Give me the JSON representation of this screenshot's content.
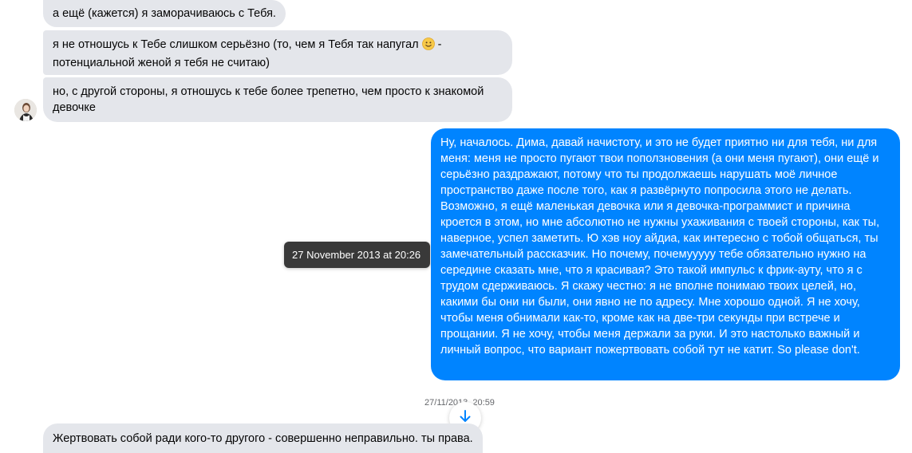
{
  "conversation": {
    "messages_in_top": [
      {
        "text": "а ещё (кажется) я заморачиваюсь  с Тебя."
      },
      {
        "text_before_emoji": "я не отношусь к Тебе слишком серьёзно (то, чем я Тебя так напугал ",
        "emoji": "slightly-smiling-face-icon",
        "text_after_emoji": " - потенциальной женой я тебя не считаю)"
      },
      {
        "text": "но, с другой стороны, я отношусь к тебе более трепетно, чем просто к знакомой девочке"
      }
    ],
    "message_out": {
      "text": "Ну, началось. Дима, давай начистоту, и это не будет приятно ни для тебя, ни для меня: меня не просто пугают твои поползновения (а они меня пугают), они ещё и серьёзно раздражают, потому что ты продолжаешь нарушать моё личное пространство даже после того, как я развёрнуто попросила этого не делать. Возможно, я ещё маленькая девочка или я девочка-программист и причина кроется в этом, но мне абсолютно не нужны ухаживания с твоей стороны, как ты, наверное, успел заметить. Ю хэв ноу айдиа, как интересно с тобой общаться, ты замечательный рассказчик. Но почему, почемууууу тебе обязательно нужно на середине сказать мне, что я красивая? Это такой импульс к фрик-ауту, что я с трудом сдерживаюсь. Я скажу честно: я не вполне понимаю твоих целей, но, какими бы они ни были, они явно не по адресу. Мне хорошо одной. Я не хочу, чтобы меня обнимали как-то, кроме как на две-три секунды при встрече и прощании. Я не хочу, чтобы меня держали за руки. И это настолько важный и личный вопрос, что вариант пожертвовать собой тут не катит. So please don't.",
      "tooltip": "27 November 2013 at 20:26"
    },
    "timestamp": "27/11/2013, 20:59",
    "message_in_bottom": {
      "text": "Жертвовать собой ради кого-то другого - совершенно неправильно. ты права."
    }
  },
  "colors": {
    "incoming_bubble": "#e4e6eb",
    "outgoing_bubble": "#0084ff",
    "accent": "#0084ff"
  },
  "icons": {
    "scroll_down": "arrow-down-icon",
    "avatar": "avatar"
  }
}
